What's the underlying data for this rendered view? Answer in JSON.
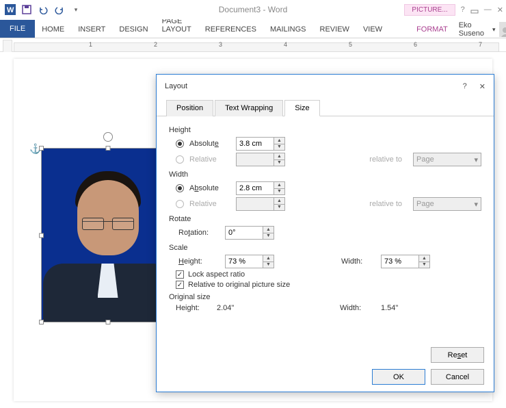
{
  "titlebar": {
    "doc_title": "Document3 - Word",
    "contextual_label": "PICTURE..."
  },
  "ribbon": {
    "file": "FILE",
    "home": "HOME",
    "insert": "INSERT",
    "design": "DESIGN",
    "page_layout": "PAGE LAYOUT",
    "references": "REFERENCES",
    "mailings": "MAILINGS",
    "review": "REVIEW",
    "view": "VIEW",
    "format": "FORMAT",
    "user_name": "Eko Suseno"
  },
  "ruler": {
    "marks": [
      "1",
      "2",
      "3",
      "4",
      "5",
      "6",
      "7"
    ]
  },
  "dialog": {
    "title": "Layout",
    "tabs": {
      "position": "Position",
      "text_wrapping": "Text Wrapping",
      "size": "Size"
    },
    "height_section": "Height",
    "width_section": "Width",
    "rotate_section": "Rotate",
    "scale_section": "Scale",
    "original_section": "Original size",
    "absolute_label": "Absolute",
    "relative_label": "Relative",
    "rotation_label": "Rotation:",
    "relative_to_label": "relative to",
    "page_option": "Page",
    "height_abs": "3.8 cm",
    "width_abs": "2.8 cm",
    "rotation_val": "0°",
    "scale_height_label": "Height:",
    "scale_width_label": "Width:",
    "scale_height": "73 %",
    "scale_width": "73 %",
    "lock_aspect": "Lock aspect ratio",
    "relative_orig": "Relative to original picture size",
    "orig_height_label": "Height:",
    "orig_width_label": "Width:",
    "orig_height": "2.04\"",
    "orig_width": "1.54\"",
    "reset": "Reset",
    "ok": "OK",
    "cancel": "Cancel"
  }
}
